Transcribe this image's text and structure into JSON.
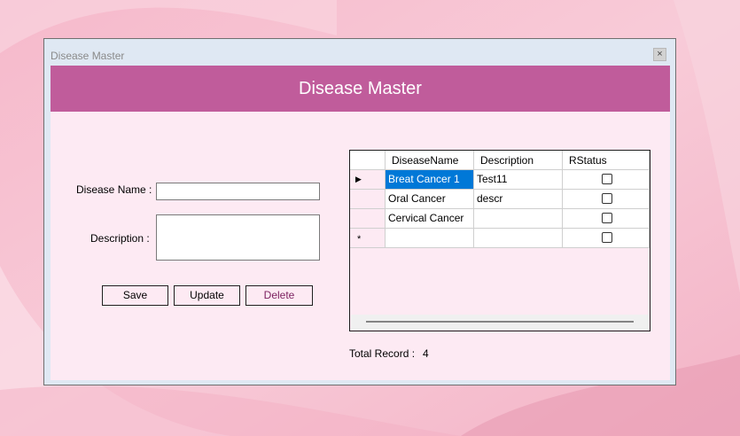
{
  "window": {
    "title": "Disease Master",
    "close_glyph": "×"
  },
  "header": {
    "title": "Disease Master"
  },
  "form": {
    "disease_name_label": "Disease Name :",
    "description_label": "Description :",
    "disease_name_value": "",
    "description_value": ""
  },
  "buttons": {
    "save": "Save",
    "update": "Update",
    "delete": "Delete"
  },
  "grid": {
    "columns": [
      "DiseaseName",
      "Description",
      "RStatus"
    ],
    "rows": [
      {
        "name": "Breat Cancer 1",
        "description": "Test11",
        "rstatus": false,
        "selected": true,
        "indicator": "▶"
      },
      {
        "name": "Oral Cancer",
        "description": "descr",
        "rstatus": false
      },
      {
        "name": "Cervical Cancer",
        "description": "",
        "rstatus": false
      },
      {
        "name": "",
        "description": "",
        "rstatus": false,
        "new_row": true,
        "indicator": "*"
      }
    ]
  },
  "footer": {
    "total_label": "Total Record :",
    "total_value": "4"
  },
  "colors": {
    "header_bg": "#c05c9b",
    "form_bg": "#fdeaf3",
    "selected_cell": "#0078d7",
    "delete_text": "#7a1f5e"
  }
}
